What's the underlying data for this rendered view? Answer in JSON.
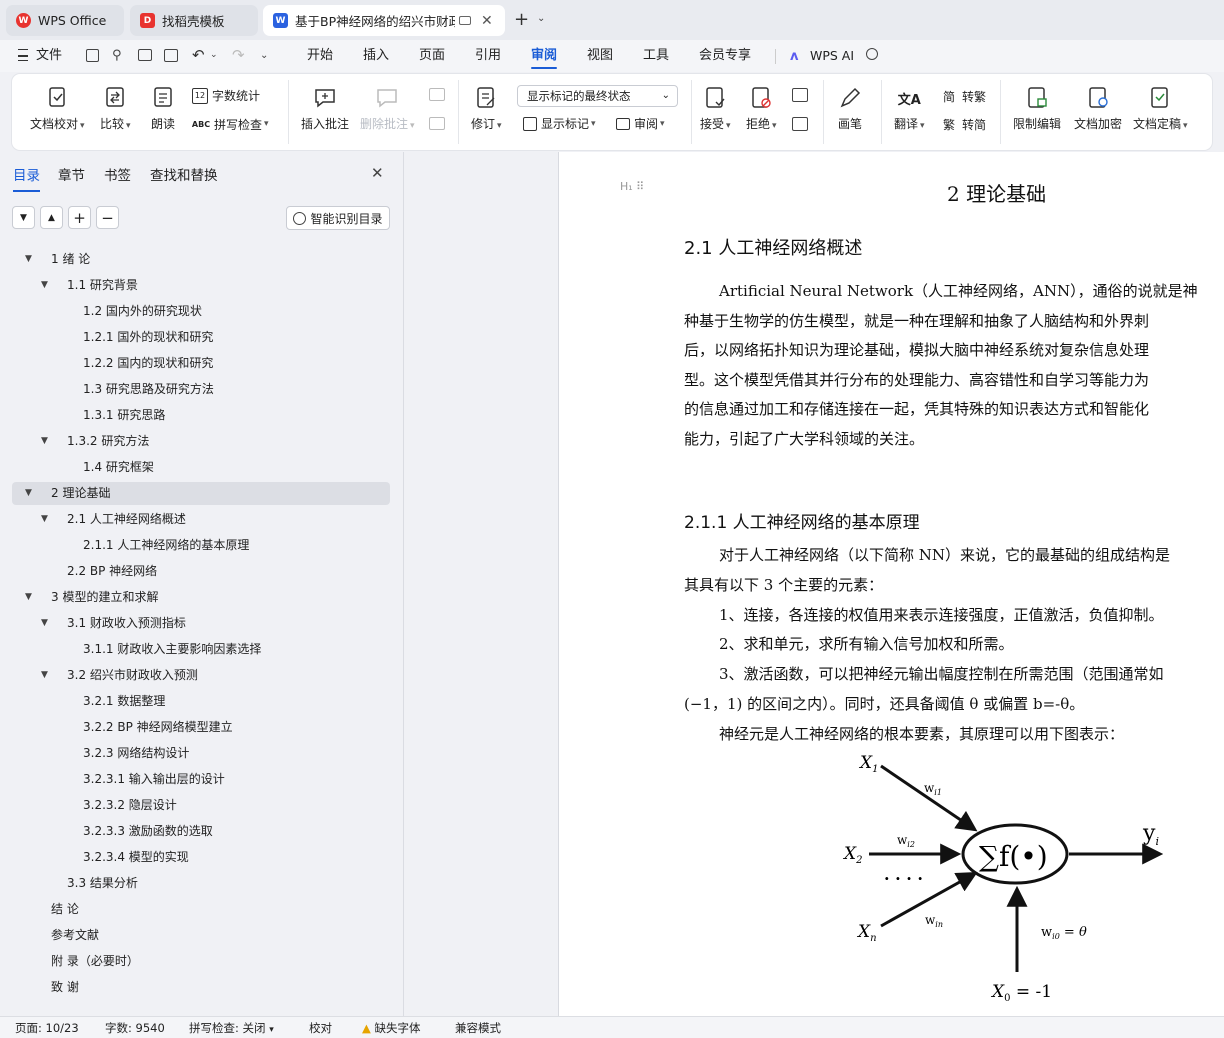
{
  "tabs": [
    {
      "label": "WPS Office"
    },
    {
      "label": "找稻壳模板"
    },
    {
      "label": "基于BP神经网络的绍兴市财政"
    }
  ],
  "menu": {
    "file": "文件",
    "items": [
      "开始",
      "插入",
      "页面",
      "引用",
      "审阅",
      "视图",
      "工具",
      "会员专享"
    ],
    "wps_ai": "WPS AI"
  },
  "ribbon": {
    "doc_check": "文档校对",
    "compare": "比较",
    "read_aloud": "朗读",
    "word_count": "字数统计",
    "spell_check": "拼写检查",
    "insert_comment": "插入批注",
    "delete_comment": "删除批注",
    "revise": "修订",
    "markup_view": "显示标记的最终状态",
    "show_markup": "显示标记",
    "review_pane": "审阅",
    "accept": "接受",
    "reject": "拒绝",
    "pen": "画笔",
    "translate": "翻译",
    "to_traditional": "转繁",
    "to_simplified": "转简",
    "restrict_edit": "限制编辑",
    "encrypt": "文档加密",
    "finalize": "文档定稿"
  },
  "panel": {
    "tabs": [
      "目录",
      "章节",
      "书签",
      "查找和替换"
    ],
    "smart_toc": "智能识别目录",
    "toc": [
      {
        "text": "1  绪  论",
        "level": 1,
        "arrow": true
      },
      {
        "text": "1.1  研究背景",
        "level": 2,
        "arrow": true
      },
      {
        "text": "1.2  国内外的研究现状",
        "level": 3
      },
      {
        "text": "1.2.1 国外的现状和研究",
        "level": 3
      },
      {
        "text": "1.2.2 国内的现状和研究",
        "level": 3
      },
      {
        "text": "1.3 研究思路及研究方法",
        "level": 3
      },
      {
        "text": "1.3.1 研究思路",
        "level": 3
      },
      {
        "text": "1.3.2  研究方法",
        "level": 2,
        "arrow": true
      },
      {
        "text": "1.4  研究框架",
        "level": 3
      },
      {
        "text": "2  理论基础",
        "level": 1,
        "arrow": true,
        "selected": true
      },
      {
        "text": "2.1  人工神经网络概述",
        "level": 2,
        "arrow": true
      },
      {
        "text": "2.1.1  人工神经网络的基本原理",
        "level": 3
      },
      {
        "text": "2.2 BP 神经网络",
        "level": 2
      },
      {
        "text": "3  模型的建立和求解",
        "level": 1,
        "arrow": true
      },
      {
        "text": "3.1 财政收入预测指标",
        "level": 2,
        "arrow": true
      },
      {
        "text": "3.1.1 财政收入主要影响因素选择",
        "level": 3
      },
      {
        "text": "3.2 绍兴市财政收入预测",
        "level": 2,
        "arrow": true
      },
      {
        "text": "3.2.1 数据整理",
        "level": 3
      },
      {
        "text": "3.2.2 BP 神经网络模型建立",
        "level": 3
      },
      {
        "text": "3.2.3 网络结构设计",
        "level": 3
      },
      {
        "text": "3.2.3.1 输入输出层的设计",
        "level": 3
      },
      {
        "text": "3.2.3.2 隐层设计",
        "level": 3
      },
      {
        "text": "3.2.3.3  激励函数的选取",
        "level": 3
      },
      {
        "text": "3.2.3.4  模型的实现",
        "level": 3
      },
      {
        "text": "3.3 结果分析",
        "level": 2
      },
      {
        "text": "结  论",
        "level": 1
      },
      {
        "text": "参考文献",
        "level": 1
      },
      {
        "text": "附  录（必要时）",
        "level": 1
      },
      {
        "text": "致  谢",
        "level": 1
      }
    ]
  },
  "doc": {
    "h1": "2  理论基础",
    "h2": "2.1  人工神经网络概述",
    "h3": "2.1.1  人工神经网络的基本原理",
    "para1": [
      "Artificial Neural Network（人工神经网络，ANN），通俗的说就是神",
      "种基于生物学的仿生模型，就是一种在理解和抽象了人脑结构和外界刺",
      "后，以网络拓扑知识为理论基础，模拟大脑中神经系统对复杂信息处理",
      "型。这个模型凭借其并行分布的处理能力、高容错性和自学习等能力为",
      "的信息通过加工和存储连接在一起，凭其特殊的知识表达方式和智能化",
      "能力，引起了广大学科领域的关注。"
    ],
    "para2": [
      "对于人工神经网络（以下简称 NN）来说，它的最基础的组成结构是",
      "其具有以下 3 个主要的元素：",
      "1、连接，各连接的权值用来表示连接强度，正值激活，负值抑制。",
      "2、求和单元，求所有输入信号加权和所需。",
      "3、激活函数，可以把神经元输出幅度控制在所需范围（范围通常如",
      "(−1，1) 的区间之内）。同时，还具备阈值 θ 或偏置 b=-θ。",
      "神经元是人工神经网络的根本要素，其原理可以用下图表示："
    ],
    "figure": {
      "x1": "X",
      "x1_sub": "1",
      "x2": "X",
      "x2_sub": "2",
      "xn": "X",
      "xn_sub": "n",
      "w1": "w",
      "w1_sub": "i1",
      "w2": "w",
      "w2_sub": "i2",
      "wn": "w",
      "wn_sub": "in",
      "dots": "· · · ·",
      "sum": "∑f(•)",
      "y": "y",
      "y_sub": "i",
      "w0": "w",
      "w0_sub": "i0",
      "w0_eq": " = θ",
      "x0": "X",
      "x0_sub": "0",
      "x0_eq": " = -1"
    }
  },
  "status": {
    "page": "页面: 10/23",
    "words": "字数: 9540",
    "spell": "拼写检查: 关闭",
    "proof": "校对",
    "missing_font": "缺失字体",
    "compat": "兼容模式"
  }
}
